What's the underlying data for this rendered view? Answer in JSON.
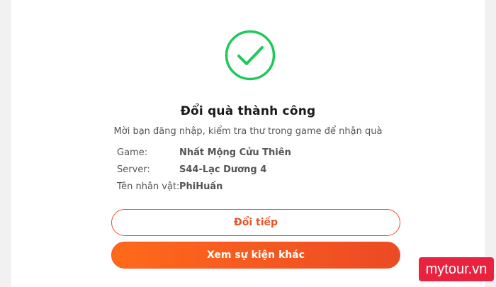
{
  "success": {
    "icon": "check-circle-icon",
    "title": "Đổi quà thành công",
    "message": "Mời bạn đăng nhập, kiểm tra thư trong game để nhận quà"
  },
  "details": [
    {
      "label": "Game:",
      "value": "Nhất Mộng Cửu Thiên"
    },
    {
      "label": "Server:",
      "value": "S44-Lạc Dương 4"
    },
    {
      "label": "Tên nhân vật:",
      "value": "PhiHuấn"
    }
  ],
  "actions": {
    "continue_label": "Đổi tiếp",
    "other_events_label": "Xem sự kiện khác"
  },
  "watermark": {
    "text": "mytour.vn"
  },
  "colors": {
    "success_green": "#1ec95a",
    "accent_orange": "#e8542a",
    "watermark_red": "#e8233f"
  }
}
